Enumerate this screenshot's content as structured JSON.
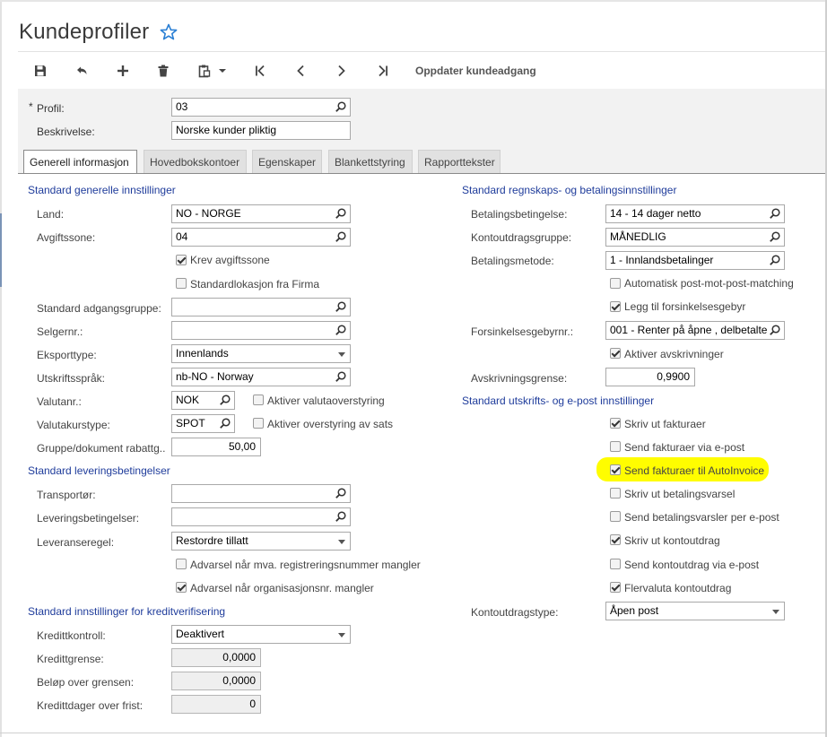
{
  "page": {
    "title": "Kundeprofiler"
  },
  "toolbar": {
    "save_icon": "floppy-disk-icon",
    "undo_icon": "undo-icon",
    "add_icon": "plus-icon",
    "delete_icon": "trash-icon",
    "copy_paste_icon": "clipboard-icon",
    "first_icon": "first-record-icon",
    "prev_icon": "previous-record-icon",
    "next_icon": "next-record-icon",
    "last_icon": "last-record-icon",
    "update_access_label": "Oppdater kundeadgang"
  },
  "header": {
    "required_mark": "*",
    "profile_label": "Profil:",
    "profile_value": "03",
    "description_label": "Beskrivelse:",
    "description_value": "Norske kunder pliktig"
  },
  "tabs": [
    {
      "label": "Generell informasjon",
      "active": true
    },
    {
      "label": "Hovedbokskontoer",
      "active": false
    },
    {
      "label": "Egenskaper",
      "active": false
    },
    {
      "label": "Blankettstyring",
      "active": false
    },
    {
      "label": "Rapporttekster",
      "active": false
    }
  ],
  "left": {
    "general_title": "Standard generelle innstillinger",
    "country_label": "Land:",
    "country_value": "NO - NORGE",
    "tax_zone_label": "Avgiftssone:",
    "tax_zone_value": "04",
    "require_tax_zone": "Krev avgiftssone",
    "require_tax_zone_checked": true,
    "default_location": "Standardlokasjon fra Firma",
    "default_location_checked": false,
    "access_group_label": "Standard adgangsgruppe:",
    "access_group_value": "",
    "salesperson_label": "Selgernr.:",
    "salesperson_value": "",
    "export_type_label": "Eksporttype:",
    "export_type_value": "Innenlands",
    "print_language_label": "Utskriftsspråk:",
    "print_language_value": "nb-NO - Norway",
    "currency_label": "Valutanr.:",
    "currency_value": "NOK",
    "currency_override": "Aktiver valutaoverstyring",
    "currency_override_checked": false,
    "rate_type_label": "Valutakurstype:",
    "rate_type_value": "SPOT",
    "rate_override": "Aktiver overstyring av sats",
    "rate_override_checked": false,
    "group_discount_label": "Gruppe/dokument rabattg..",
    "group_discount_value": "50,00",
    "delivery_title": "Standard leveringsbetingelser",
    "carrier_label": "Transportør:",
    "carrier_value": "",
    "delivery_terms_label": "Leveringsbetingelser:",
    "delivery_terms_value": "",
    "shipping_rule_label": "Leveranseregel:",
    "shipping_rule_value": "Restordre tillatt",
    "warn_vat_missing": "Advarsel når mva. registreringsnummer mangler",
    "warn_vat_missing_checked": false,
    "warn_org_missing": "Advarsel når organisasjonsnr. mangler",
    "warn_org_missing_checked": true,
    "credit_title": "Standard innstillinger for kreditverifisering",
    "credit_check_label": "Kredittkontroll:",
    "credit_check_value": "Deaktivert",
    "credit_limit_label": "Kredittgrense:",
    "credit_limit_value": "0,0000",
    "over_limit_label": "Beløp over grensen:",
    "over_limit_value": "0,0000",
    "overdue_days_label": "Kredittdager over frist:",
    "overdue_days_value": "0"
  },
  "right": {
    "accounting_title": "Standard regnskaps- og betalingsinnstillinger",
    "payment_terms_label": "Betalingsbetingelse:",
    "payment_terms_value": "14 - 14 dager netto",
    "statement_group_label": "Kontoutdragsgruppe:",
    "statement_group_value": "MÅNEDLIG",
    "payment_method_label": "Betalingsmetode:",
    "payment_method_value": "1 - Innlandsbetalinger",
    "auto_matching": "Automatisk post-mot-post-matching",
    "auto_matching_checked": false,
    "add_late_fee": "Legg til forsinkelsesgebyr",
    "add_late_fee_checked": true,
    "late_fee_label": "Forsinkelsesgebyrnr.:",
    "late_fee_value": "001 - Renter på åpne , delbetalte",
    "enable_writeoff": "Aktiver avskrivninger",
    "enable_writeoff_checked": true,
    "writeoff_limit_label": "Avskrivningsgrense:",
    "writeoff_limit_value": "0,9900",
    "print_title": "Standard utskrifts- og e-post innstillinger",
    "print_invoices": "Skriv ut fakturaer",
    "print_invoices_checked": true,
    "email_invoices": "Send fakturaer via e-post",
    "email_invoices_checked": false,
    "autoinvoice": "Send fakturaer til AutoInvoice",
    "autoinvoice_checked": true,
    "print_dunning": "Skriv ut betalingsvarsel",
    "print_dunning_checked": false,
    "email_dunning": "Send betalingsvarsler per e-post",
    "email_dunning_checked": false,
    "print_statement": "Skriv ut kontoutdrag",
    "print_statement_checked": true,
    "email_statement": "Send kontoutdrag via e-post",
    "email_statement_checked": false,
    "multicurrency_statement": "Flervaluta kontoutdrag",
    "multicurrency_statement_checked": true,
    "statement_type_label": "Kontoutdragstype:",
    "statement_type_value": "Åpen post"
  },
  "colors": {
    "section_title": "#1f3c9b",
    "highlight": "#fffd00",
    "star": "#2a7fd4"
  }
}
